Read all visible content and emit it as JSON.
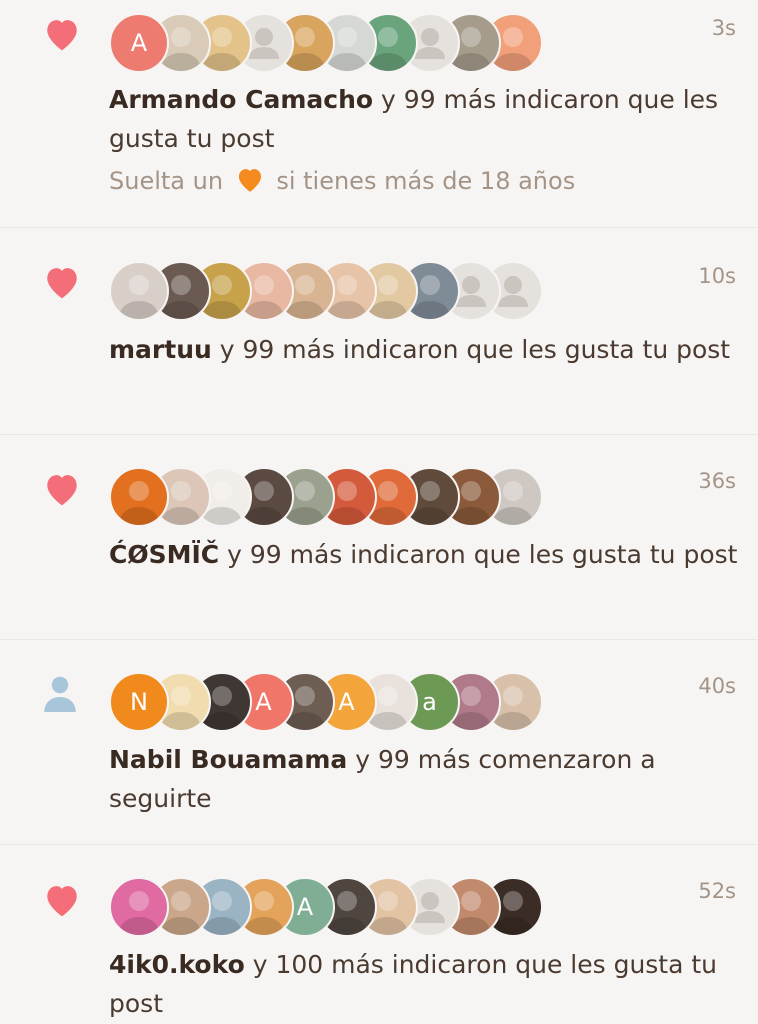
{
  "colors": {
    "heart": "#f36e78",
    "follow": "#a8c6da",
    "text": "#4a3a30",
    "muted": "#a39487",
    "orange_heart": "#f58a1f"
  },
  "notifications": [
    {
      "type": "like",
      "icon": "heart-icon",
      "time": "3s",
      "user": "Armando Camacho",
      "rest": " y 99 más indicaron que les gusta tu post",
      "sub_before": "Suelta un ",
      "sub_emoji": "orange-heart-icon",
      "sub_after": " si tienes más de 18 años",
      "avatars": [
        {
          "letter": "A",
          "color": "#ee7b70"
        },
        {
          "letter": "",
          "color": "#d9cbb7"
        },
        {
          "letter": "",
          "color": "#e3c38a"
        },
        {
          "letter": "",
          "color": "#e5e1dd",
          "placeholder": true
        },
        {
          "letter": "",
          "color": "#d8a45e"
        },
        {
          "letter": "",
          "color": "#d6d9d3"
        },
        {
          "letter": "",
          "color": "#6aa47c"
        },
        {
          "letter": "",
          "color": "#e5e1dd",
          "placeholder": true
        },
        {
          "letter": "",
          "color": "#a69c8c"
        },
        {
          "letter": "",
          "color": "#f2a07a"
        }
      ]
    },
    {
      "type": "like",
      "icon": "heart-icon",
      "time": "10s",
      "user": "martuu",
      "rest": " y 99 más indicaron que les gusta tu post",
      "avatars": [
        {
          "letter": "",
          "color": "#d9cfc9"
        },
        {
          "letter": "",
          "color": "#6b5a52"
        },
        {
          "letter": "",
          "color": "#c7a24a"
        },
        {
          "letter": "",
          "color": "#e9b8a2"
        },
        {
          "letter": "",
          "color": "#d8b492"
        },
        {
          "letter": "",
          "color": "#e7c3a8"
        },
        {
          "letter": "",
          "color": "#e2c9a2"
        },
        {
          "letter": "",
          "color": "#7f8b97"
        },
        {
          "letter": "",
          "color": "#e5e1dd",
          "placeholder": true
        },
        {
          "letter": "",
          "color": "#e5e1dd",
          "placeholder": true
        }
      ]
    },
    {
      "type": "like",
      "icon": "heart-icon",
      "time": "36s",
      "user": "ĆØSMÏČ",
      "rest": " y 99 más indicaron que les gusta tu post",
      "avatars": [
        {
          "letter": "",
          "color": "#e2701f"
        },
        {
          "letter": "",
          "color": "#dcc6b8"
        },
        {
          "letter": "",
          "color": "#f1ede8"
        },
        {
          "letter": "",
          "color": "#5a4a42"
        },
        {
          "letter": "",
          "color": "#9aa18e"
        },
        {
          "letter": "",
          "color": "#d45a3c"
        },
        {
          "letter": "",
          "color": "#e06a3a"
        },
        {
          "letter": "",
          "color": "#5f4a3c"
        },
        {
          "letter": "",
          "color": "#8a5a3a"
        },
        {
          "letter": "",
          "color": "#cfc8c2"
        }
      ]
    },
    {
      "type": "follow",
      "icon": "person-icon",
      "time": "40s",
      "user": "Nabil Bouamama",
      "rest": " y 99 más comenzaron a seguirte",
      "avatars": [
        {
          "letter": "N",
          "color": "#f08a1d"
        },
        {
          "letter": "",
          "color": "#f0dcae"
        },
        {
          "letter": "",
          "color": "#3f3733"
        },
        {
          "letter": "A",
          "color": "#ef7668"
        },
        {
          "letter": "",
          "color": "#6d5d52"
        },
        {
          "letter": "A",
          "color": "#f3a43a"
        },
        {
          "letter": "",
          "color": "#e9e2dc"
        },
        {
          "letter": "a",
          "color": "#6c9a55"
        },
        {
          "letter": "",
          "color": "#b07a8a"
        },
        {
          "letter": "",
          "color": "#d9c0ab"
        }
      ]
    },
    {
      "type": "like",
      "icon": "heart-icon",
      "time": "52s",
      "user": "4ik0.koko",
      "rest": " y 100 más indicaron que les gusta tu post",
      "avatars": [
        {
          "letter": "",
          "color": "#e06aa2"
        },
        {
          "letter": "",
          "color": "#caa78a"
        },
        {
          "letter": "",
          "color": "#9ab4c4"
        },
        {
          "letter": "",
          "color": "#e3a35a"
        },
        {
          "letter": "A",
          "color": "#7fae94"
        },
        {
          "letter": "",
          "color": "#4f4640"
        },
        {
          "letter": "",
          "color": "#e2c3a4"
        },
        {
          "letter": "",
          "color": "#e5e1dd",
          "placeholder": true
        },
        {
          "letter": "",
          "color": "#c28a6c"
        },
        {
          "letter": "",
          "color": "#3b2c25"
        }
      ]
    }
  ]
}
